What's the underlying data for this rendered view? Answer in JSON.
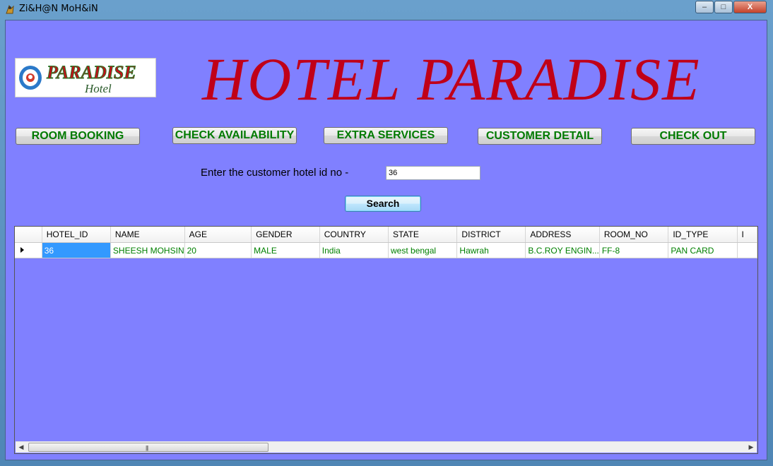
{
  "window": {
    "title": "Zi&H@N MoH&iN",
    "controls": {
      "minimize": "–",
      "maximize": "□",
      "close": "X"
    }
  },
  "header": {
    "logo_text": "PARADISE",
    "logo_subtext": "Hotel",
    "headline": "HOTEL PARADISE"
  },
  "nav": {
    "room_booking": "ROOM BOOKING",
    "check_availability": "CHECK AVAILABILITY",
    "extra_services": "EXTRA SERVICES",
    "customer_detail": "CUSTOMER DETAIL",
    "check_out": "CHECK OUT"
  },
  "search": {
    "prompt": "Enter the customer hotel id no -",
    "value": "36",
    "button": "Search"
  },
  "grid": {
    "columns": [
      "HOTEL_ID",
      "NAME",
      "AGE",
      "GENDER",
      "COUNTRY",
      "STATE",
      "DISTRICT",
      "ADDRESS",
      "ROOM_NO",
      "ID_TYPE"
    ],
    "rows": [
      [
        "36",
        "SHEESH MOHSIN",
        "20",
        "MALE",
        "India",
        "west bengal",
        "Hawrah",
        "B.C.ROY ENGIN...",
        "FF-8",
        "PAN CARD"
      ]
    ]
  },
  "colors": {
    "background": "#8080ff",
    "headline": "#c00018",
    "nav_text": "#007a00",
    "cell_text": "#008000",
    "selection": "#3399ff"
  }
}
